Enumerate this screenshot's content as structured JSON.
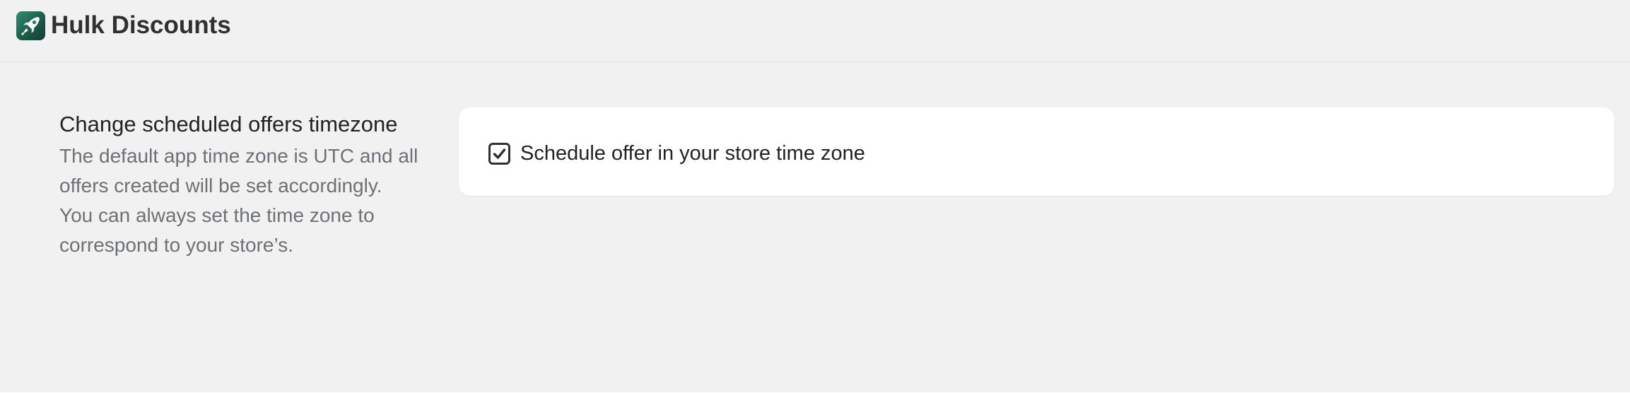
{
  "header": {
    "app_name": "Hulk Discounts",
    "logo_icon": "rocket-icon",
    "brand_color": "#1c5c4a"
  },
  "timezone_section": {
    "heading": "Change scheduled offers timezone",
    "description": "The default app time zone is UTC and all offers created will be set accordingly. You can always set the time zone to correspond to your store’s.",
    "checkbox": {
      "label": "Schedule offer in your store time zone",
      "checked": true
    }
  }
}
